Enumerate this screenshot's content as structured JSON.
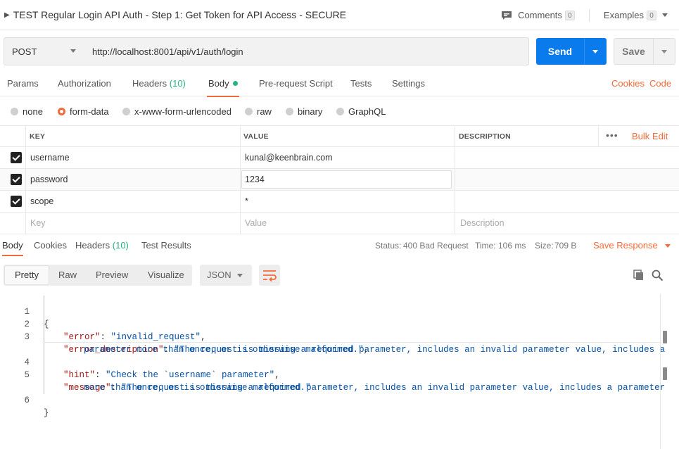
{
  "request": {
    "title": "TEST Regular Login API Auth - Step 1: Get Token for API Access - SECURE",
    "comments_label": "Comments",
    "comments_count": "0",
    "examples_label": "Examples",
    "examples_count": "0",
    "method": "POST",
    "url": "http://localhost:8001/api/v1/auth/login",
    "send_label": "Send",
    "save_label": "Save"
  },
  "tabs": {
    "params": "Params",
    "authorization": "Authorization",
    "headers": "Headers",
    "headers_count": "(10)",
    "body": "Body",
    "prerequest": "Pre-request Script",
    "tests": "Tests",
    "settings": "Settings",
    "cookies": "Cookies",
    "code": "Code"
  },
  "body_types": [
    "none",
    "form-data",
    "x-www-form-urlencoded",
    "raw",
    "binary",
    "GraphQL"
  ],
  "body_type_selected": "form-data",
  "params_table": {
    "headers": {
      "key": "KEY",
      "value": "VALUE",
      "description": "DESCRIPTION",
      "bulk_edit": "Bulk Edit",
      "more": "•••"
    },
    "rows": [
      {
        "key": "username",
        "value": "kunal@keenbrain.com",
        "checked": true
      },
      {
        "key": "password",
        "value": "1234",
        "checked": true
      },
      {
        "key": "scope",
        "value": "*",
        "checked": true
      }
    ],
    "placeholder": {
      "key": "Key",
      "value": "Value",
      "description": "Description"
    }
  },
  "response": {
    "tabs": {
      "body": "Body",
      "cookies": "Cookies",
      "headers": "Headers",
      "headers_count": "(10)",
      "test_results": "Test Results"
    },
    "status_label": "Status:",
    "status_value": "400 Bad Request",
    "time_label": "Time:",
    "time_value": "106 ms",
    "size_label": "Size:",
    "size_value": "709 B",
    "save_response": "Save Response",
    "view_modes": [
      "Pretty",
      "Raw",
      "Preview",
      "Visualize"
    ],
    "format": "JSON"
  },
  "code": {
    "line_numbers": [
      "1",
      "2",
      "3",
      "4",
      "5",
      "6"
    ],
    "open_brace": "{",
    "close_brace": "}",
    "error_key": "\"error\"",
    "error_value": "\"invalid_request\"",
    "desc_key": "\"error_description\"",
    "desc_value_1": "\"The request is missing a required parameter, includes an invalid parameter value, includes a",
    "desc_value_2": "parameter more than once, or is otherwise malformed.\"",
    "hint_key": "\"hint\"",
    "hint_value": "\"Check the `username` parameter\"",
    "message_key": "\"message\"",
    "message_value_1": "\"The request is missing a required parameter, includes an invalid parameter value, includes a parameter",
    "message_value_2": "more than once, or is otherwise malformed.\""
  },
  "colors": {
    "accent": "#f26b3a",
    "send": "#097bed",
    "success": "#26b47f",
    "json_key": "#a31515",
    "json_string": "#0451a5"
  }
}
